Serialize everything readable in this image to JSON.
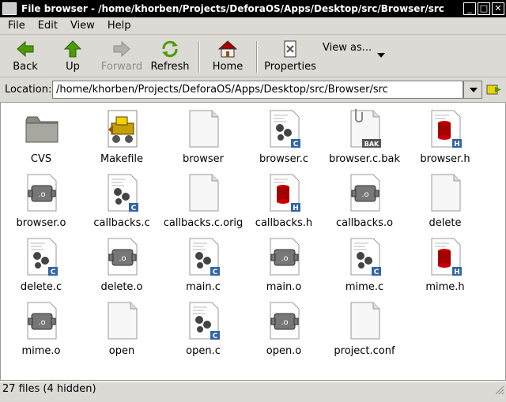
{
  "window": {
    "title": "File browser - /home/khorben/Projects/DeforaOS/Apps/Desktop/src/Browser/src"
  },
  "menu": [
    "File",
    "Edit",
    "View",
    "Help"
  ],
  "toolbar": {
    "back": "Back",
    "up": "Up",
    "forward": "Forward",
    "refresh": "Refresh",
    "home": "Home",
    "properties": "Properties",
    "view_as": "View as..."
  },
  "location": {
    "label": "Location:",
    "value": "/home/khorben/Projects/DeforaOS/Apps/Desktop/src/Browser/src"
  },
  "files": [
    {
      "name": "CVS",
      "type": "folder"
    },
    {
      "name": "Makefile",
      "type": "makefile"
    },
    {
      "name": "browser",
      "type": "blank"
    },
    {
      "name": "browser.c",
      "type": "c-source"
    },
    {
      "name": "browser.c.bak",
      "type": "backup"
    },
    {
      "name": "browser.h",
      "type": "c-header"
    },
    {
      "name": "browser.o",
      "type": "object"
    },
    {
      "name": "callbacks.c",
      "type": "c-source"
    },
    {
      "name": "callbacks.c.orig",
      "type": "blank"
    },
    {
      "name": "callbacks.h",
      "type": "c-header"
    },
    {
      "name": "callbacks.o",
      "type": "object"
    },
    {
      "name": "delete",
      "type": "blank"
    },
    {
      "name": "delete.c",
      "type": "c-source"
    },
    {
      "name": "delete.o",
      "type": "object"
    },
    {
      "name": "main.c",
      "type": "c-source"
    },
    {
      "name": "main.o",
      "type": "object"
    },
    {
      "name": "mime.c",
      "type": "c-source"
    },
    {
      "name": "mime.h",
      "type": "c-header"
    },
    {
      "name": "mime.o",
      "type": "object"
    },
    {
      "name": "open",
      "type": "blank"
    },
    {
      "name": "open.c",
      "type": "c-source"
    },
    {
      "name": "open.o",
      "type": "object"
    },
    {
      "name": "project.conf",
      "type": "blank"
    }
  ],
  "status": "27 files (4 hidden)"
}
